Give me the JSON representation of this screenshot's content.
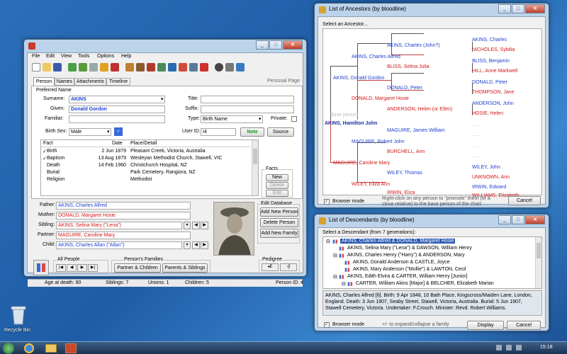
{
  "desktop": {
    "recycle_bin": "Recycle Bin",
    "clock": "15:18"
  },
  "main_window": {
    "title": "",
    "menu": [
      "File",
      "Edit",
      "View",
      "Tools",
      "Options",
      "Help"
    ],
    "tabs": [
      "Person",
      "Names",
      "Attachments",
      "Timeline"
    ],
    "personal_page": "Personal Page",
    "preferred_name": "Preferred Name",
    "surname_label": "Surname:",
    "surname": "AKINS",
    "given_label": "Given:",
    "given": "Donald Gordon",
    "familiar_label": "Familiar:",
    "familiar": "",
    "title_label": "Title:",
    "suffix_label": "Suffix:",
    "suffix": "",
    "type_label": "Type:",
    "type": "Birth Name",
    "private_label": "Private:",
    "birth_sex_label": "Birth Sex:",
    "birth_sex": "Male",
    "user_id_label": "User ID:",
    "user_id": "I4",
    "note_btn": "Note",
    "source_btn": "Source",
    "facts_header": [
      "Fact",
      "Date",
      "Place/Detail"
    ],
    "facts": [
      {
        "check": "✓",
        "fact": "Birth",
        "date": "2 Jun 1879",
        "place": "Pleasant Creek, Victoria, Australia"
      },
      {
        "check": "✓",
        "fact": "Baptism",
        "date": "13 Aug 1879",
        "place": "Wesleyan Methodist Church, Stawell, VIC"
      },
      {
        "check": "",
        "fact": "Death",
        "date": "14 Feb 1960",
        "place": "Christchurch Hospital, NZ"
      },
      {
        "check": "",
        "fact": "Burial",
        "date": "",
        "place": "Park Cemetery, Rangiora, NZ"
      },
      {
        "check": "",
        "fact": "Religion",
        "date": "",
        "place": "Methodist"
      }
    ],
    "facts_group": "Facts",
    "facts_new": "New",
    "facts_delete": "Delete",
    "facts_edit": "Edit",
    "father_label": "Father:",
    "father": "AKINS, Charles Alfred",
    "mother_label": "Mother:",
    "mother": "DONALD, Margaret Hosie",
    "sibling_label": "Sibling:",
    "sibling": "AKINS, Selina Mary (\"Lena\")",
    "partner_label": "Partner:",
    "partner": "MAGUIRE, Caroline Mary",
    "child_label": "Child:",
    "child": "AKINS, Charles Allan (\"Allan\")",
    "edit_db": "Edit Database",
    "add_new_person": "Add New Person",
    "delete_person": "Delete Person",
    "add_new_family": "Add New Family",
    "all_people": "All People",
    "persons_families": "Person's Families",
    "partner_children_btn": "Partner & Children",
    "parents_siblings_btn": "Parents & Siblings",
    "pedigree": "Pedigree",
    "age_at_death": "Age at death: 80",
    "siblings": "Siblings: 7",
    "unions": "Unions: 1",
    "children": "Children: 5",
    "person_id": "Person ID: 4"
  },
  "ancestors_window": {
    "title": "List of Ancestors (by bloodline)",
    "select_label": "Select an Ancestor...",
    "base_person_label": "Base person",
    "people": {
      "akins_hamilton": "AKINS, Hamilton John",
      "akins_donald": "AKINS, Donald Gordon",
      "maguire_caroline": "MAGUIRE, Caroline Mary",
      "akins_charles_alfred": "AKINS, Charles Alfred",
      "donald_margaret": "DONALD, Margaret Hosie",
      "maguire_robert": "MAGUIRE, Robert John",
      "wiley_eliza": "WILEY, Eliza Ann",
      "akins_charles_john": "AKINS, Charles (John?)",
      "bliss_selina": "BLISS, Selina Julia",
      "donald_peter": "DONALD, Peter",
      "anderson_helen": "ANDERSON, Helen (or Ellen)",
      "maguire_james": "MAGUIRE, James William",
      "burchell_ann": "BURCHELL, Ann",
      "wiley_thomas": "WILEY, Thomas",
      "irwin_eliza": "IRWIN, Eliza",
      "akins_charles": "AKINS, Charles",
      "nicholes_sybilia": "NICHOLES, Sybilia",
      "bliss_benjamin": "BLISS, Benjamin",
      "hill_anne": "HILL, Anne Markwell",
      "donald_peter2": "DONALD, Peter",
      "thompson_jane": "THOMPSON, Jane",
      "anderson_john": "ANDERSON, John",
      "hosie_helen": "HOSIE, Helen",
      "wiley_john": "WILEY, John",
      "unknown_ann": "UNKNOWN, Ann",
      "irwin_edward": "IRWIN, Edward",
      "williams_elizabeth": "WILLIAMS, Elizabeth"
    },
    "dots": ". . .",
    "browser_mode": "Browser mode",
    "hint": "Right-click on any person to \"promote\" them (or a close relative) to the base person of the chart",
    "cancel": "Cancel"
  },
  "descendants_window": {
    "title": "List of Descendants (by bloodline)",
    "select_label": "Select a Descendant (from 7 generations):",
    "rows": [
      "AKINS, Charles Alfred & DONALD, Margaret Hosie",
      "AKINS, Selina Mary (\"Lena\") & DAWSON, William Henry",
      "AKINS, Charles Henry (\"Harry\") & ANDERSON, Mary",
      "AKINS, Donald Anderson & CASTLE, Joyce",
      "AKINS, Mary Anderson (\"Mollie\") & LAWTON, Cecil",
      "AKINS, Edith Elvira & CARTER, William Henry [Junior]",
      "CARTER, William Akins [Major] & BELCHER, Elizabeth Marian"
    ],
    "detail": "AKINS, Charles Alfred [6]. Birth: 9 Apr 1848, 10 Bath Place, Kingscross/Maiden Lane, London, England. Death: 3 Jun 1907, Seaby Street, Stawell, Victoria, Australia. Burial: 5 Jun 1907, Stawell Cemetery, Victoria. Undertaker: F.Crouch. Minister: Revd. Robert Williams.",
    "browser_mode": "Browser mode",
    "hint": "+/- to expand/collapse a family",
    "display": "Display",
    "cancel": "Cancel"
  }
}
